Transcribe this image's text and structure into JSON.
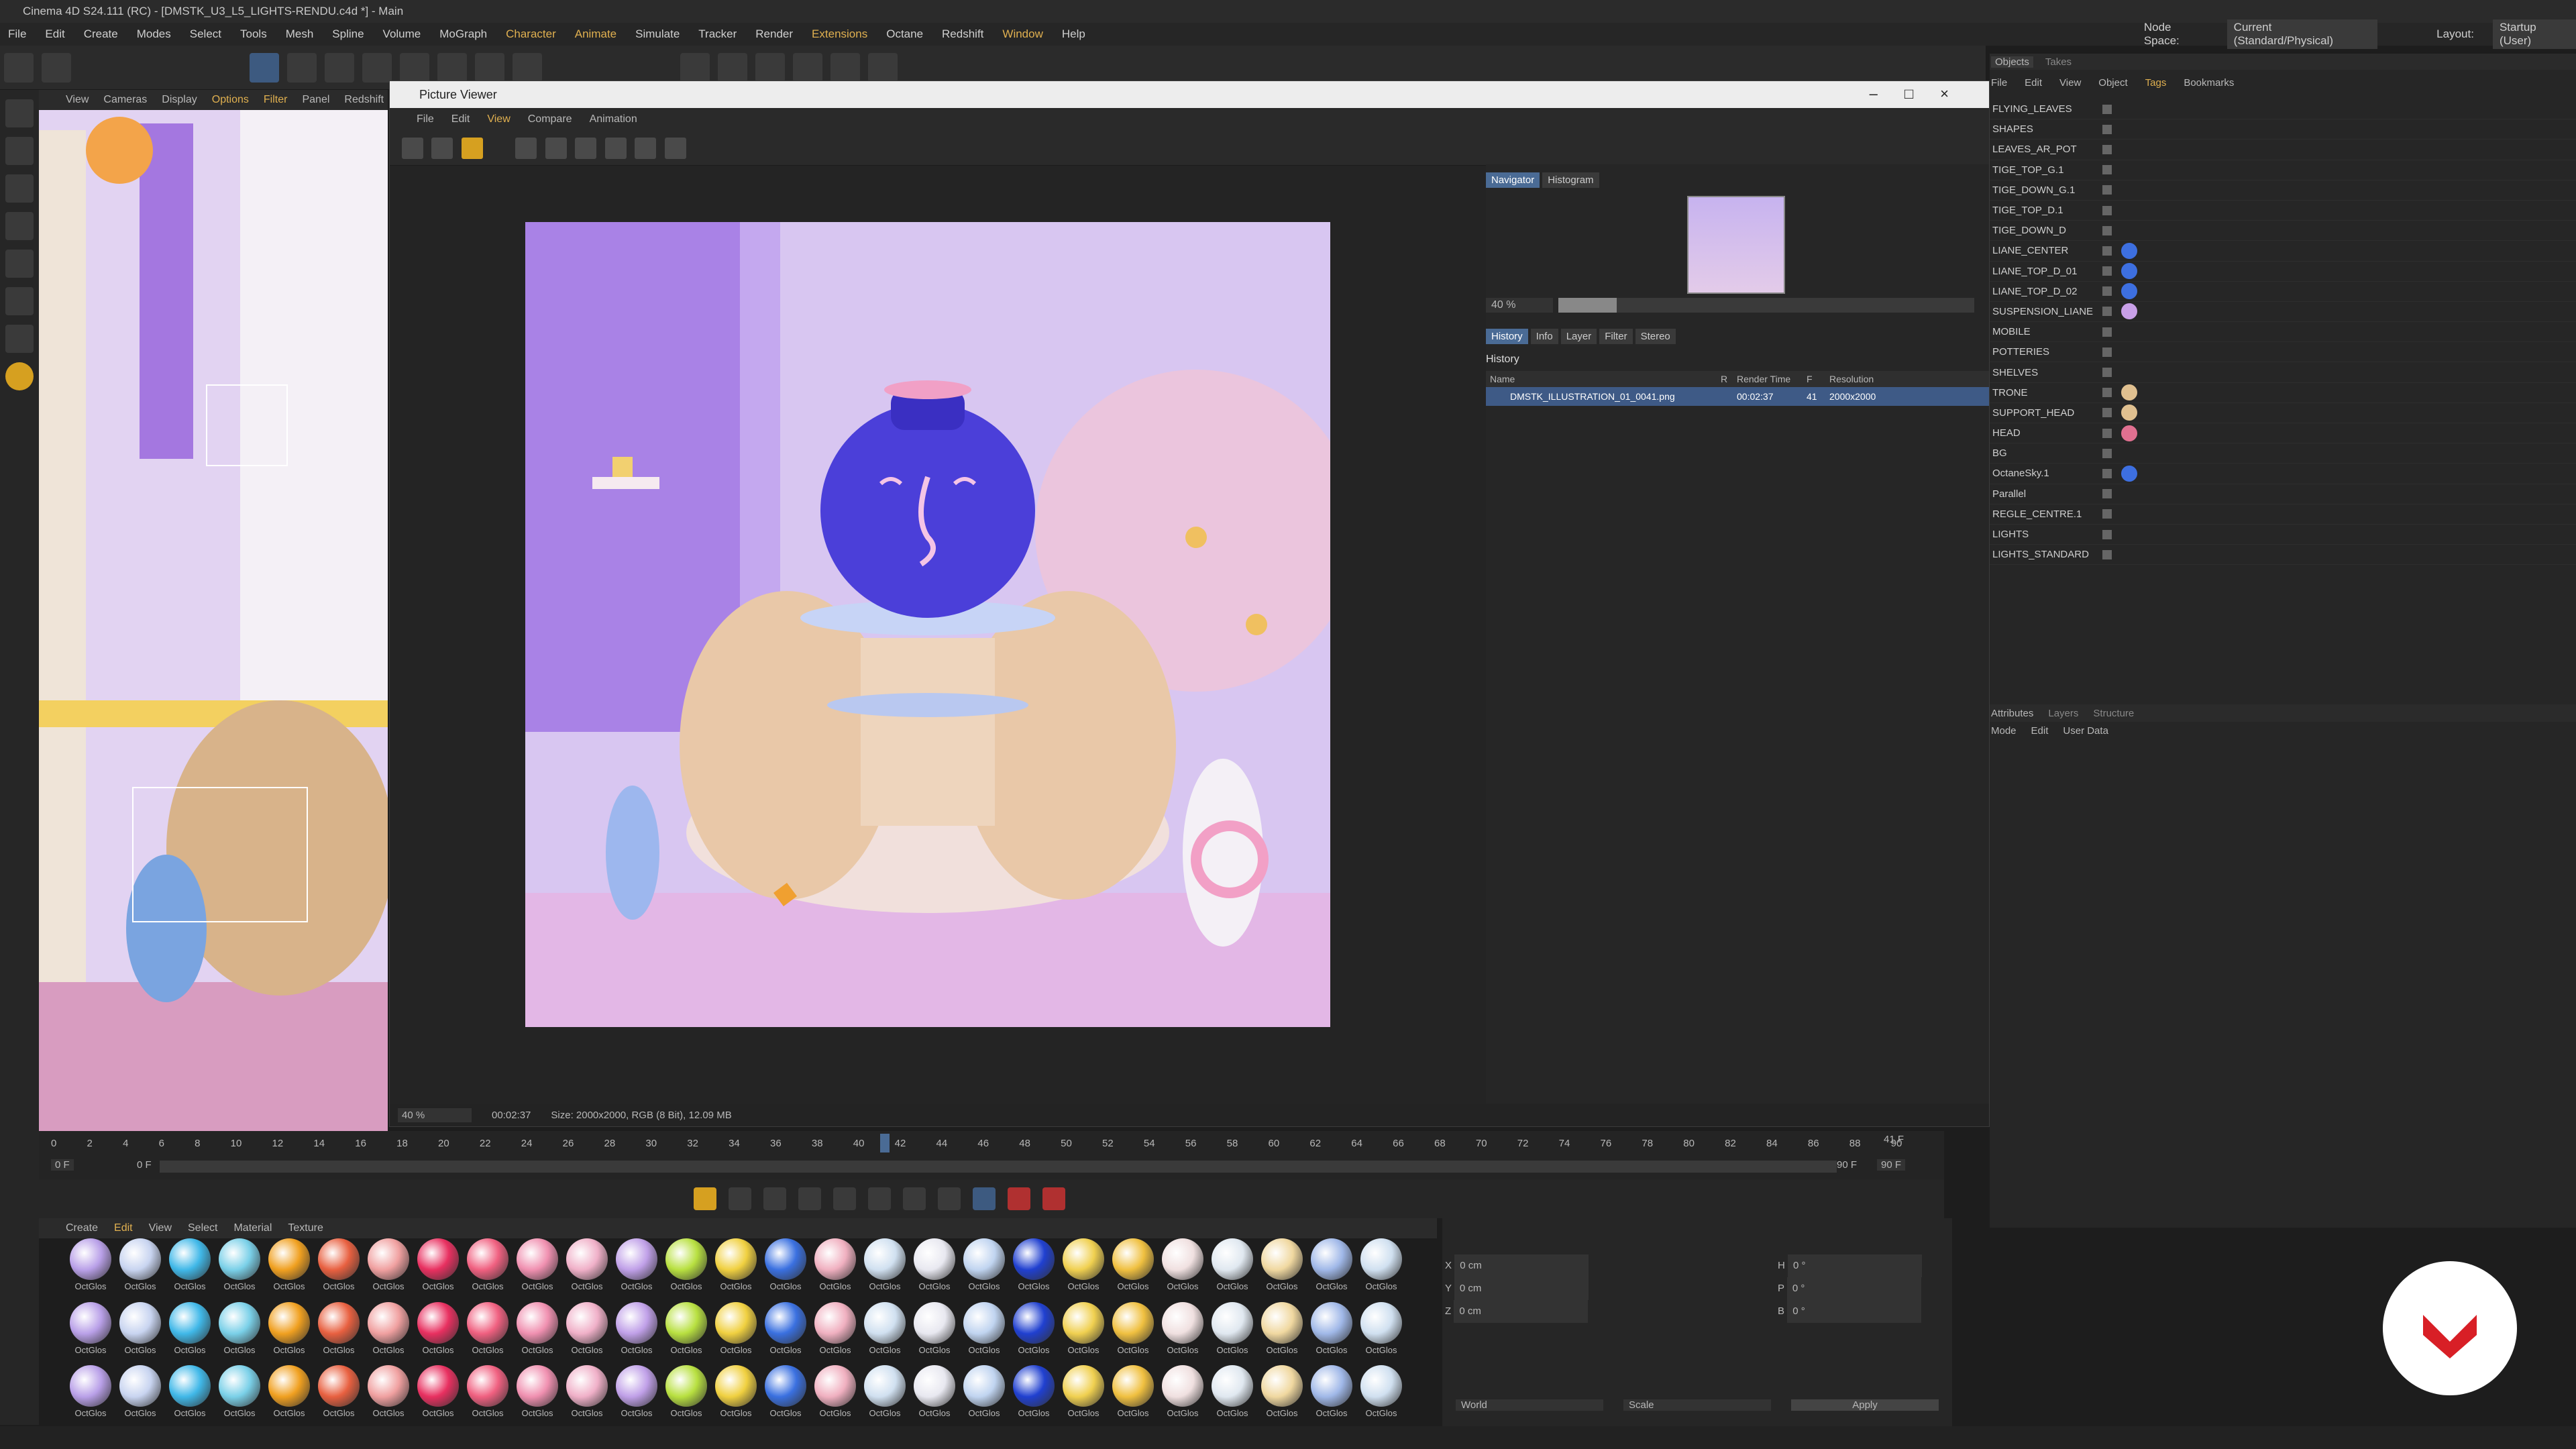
{
  "window": {
    "title": "Cinema 4D S24.111 (RC) - [DMSTK_U3_L5_LIGHTS-RENDU.c4d *] - Main"
  },
  "menu": [
    "File",
    "Edit",
    "Create",
    "Modes",
    "Select",
    "Tools",
    "Mesh",
    "Spline",
    "Volume",
    "MoGraph",
    "Character",
    "Animate",
    "Simulate",
    "Tracker",
    "Render",
    "Extensions",
    "Octane",
    "Redshift",
    "Window",
    "Help"
  ],
  "nodespace": {
    "label": "Node Space:",
    "value": "Current (Standard/Physical)"
  },
  "layout": {
    "label": "Layout:",
    "value": "Startup (User)"
  },
  "viewport": {
    "menu": [
      "View",
      "Cameras",
      "Display",
      "Options",
      "Filter",
      "Panel",
      "Redshift"
    ]
  },
  "picture_viewer": {
    "title": "Picture Viewer",
    "menu": [
      "File",
      "Edit",
      "View",
      "Compare",
      "Animation"
    ],
    "nav_tabs": [
      "Navigator",
      "Histogram"
    ],
    "zoom": "40 %",
    "tabs": [
      "History",
      "Info",
      "Layer",
      "Filter",
      "Stereo"
    ],
    "history_title": "History",
    "columns": [
      "Name",
      "R",
      "Render Time",
      "F",
      "Resolution"
    ],
    "row": {
      "name": "DMSTK_ILLUSTRATION_01_0041.png",
      "time": "00:02:37",
      "frame": "41",
      "res": "2000x2000"
    },
    "status": {
      "zoom": "40 %",
      "time": "00:02:37",
      "size": "Size: 2000x2000, RGB (8 Bit), 12.09 MB"
    }
  },
  "objects": {
    "tabs": [
      "Objects",
      "Takes"
    ],
    "menu": [
      "File",
      "Edit",
      "View",
      "Object",
      "Tags",
      "Bookmarks"
    ],
    "items": [
      "FLYING_LEAVES",
      "SHAPES",
      "LEAVES_AR_POT",
      "TIGE_TOP_G.1",
      "TIGE_DOWN_G.1",
      "TIGE_TOP_D.1",
      "TIGE_DOWN_D",
      "LIANE_CENTER",
      "LIANE_TOP_D_01",
      "LIANE_TOP_D_02",
      "SUSPENSION_LIANE",
      "MOBILE",
      "POTTERIES",
      "SHELVES",
      "TRONE",
      "SUPPORT_HEAD",
      "HEAD",
      "BG",
      "OctaneSky.1",
      "Parallel",
      "REGLE_CENTRE.1",
      "LIGHTS",
      "LIGHTS_STANDARD"
    ]
  },
  "attributes": {
    "tabs": [
      "Attributes",
      "Layers",
      "Structure"
    ],
    "menu": [
      "Mode",
      "Edit",
      "User Data"
    ]
  },
  "timeline": {
    "ticks": [
      "0",
      "2",
      "4",
      "6",
      "8",
      "10",
      "12",
      "14",
      "16",
      "18",
      "20",
      "22",
      "24",
      "26",
      "28",
      "30",
      "32",
      "34",
      "36",
      "38",
      "40",
      "42",
      "44",
      "46",
      "48",
      "50",
      "52",
      "54",
      "56",
      "58",
      "60",
      "62",
      "64",
      "66",
      "68",
      "70",
      "72",
      "74",
      "76",
      "78",
      "80",
      "82",
      "84",
      "86",
      "88",
      "90"
    ],
    "current": "41 F",
    "start": "0 F",
    "start2": "0 F",
    "end": "90 F",
    "end2": "90 F"
  },
  "materials": {
    "menu": [
      "Create",
      "Edit",
      "View",
      "Select",
      "Material",
      "Texture"
    ],
    "label": "OctGlos"
  },
  "coords": {
    "x": "0 cm",
    "y": "0 cm",
    "z": "0 cm",
    "h": "0 °",
    "p": "0 °",
    "b": "0 °",
    "world": "World",
    "scale": "Scale",
    "apply": "Apply"
  },
  "colors": {
    "accent": "#4a6b95",
    "highlight": "#e0b050"
  }
}
